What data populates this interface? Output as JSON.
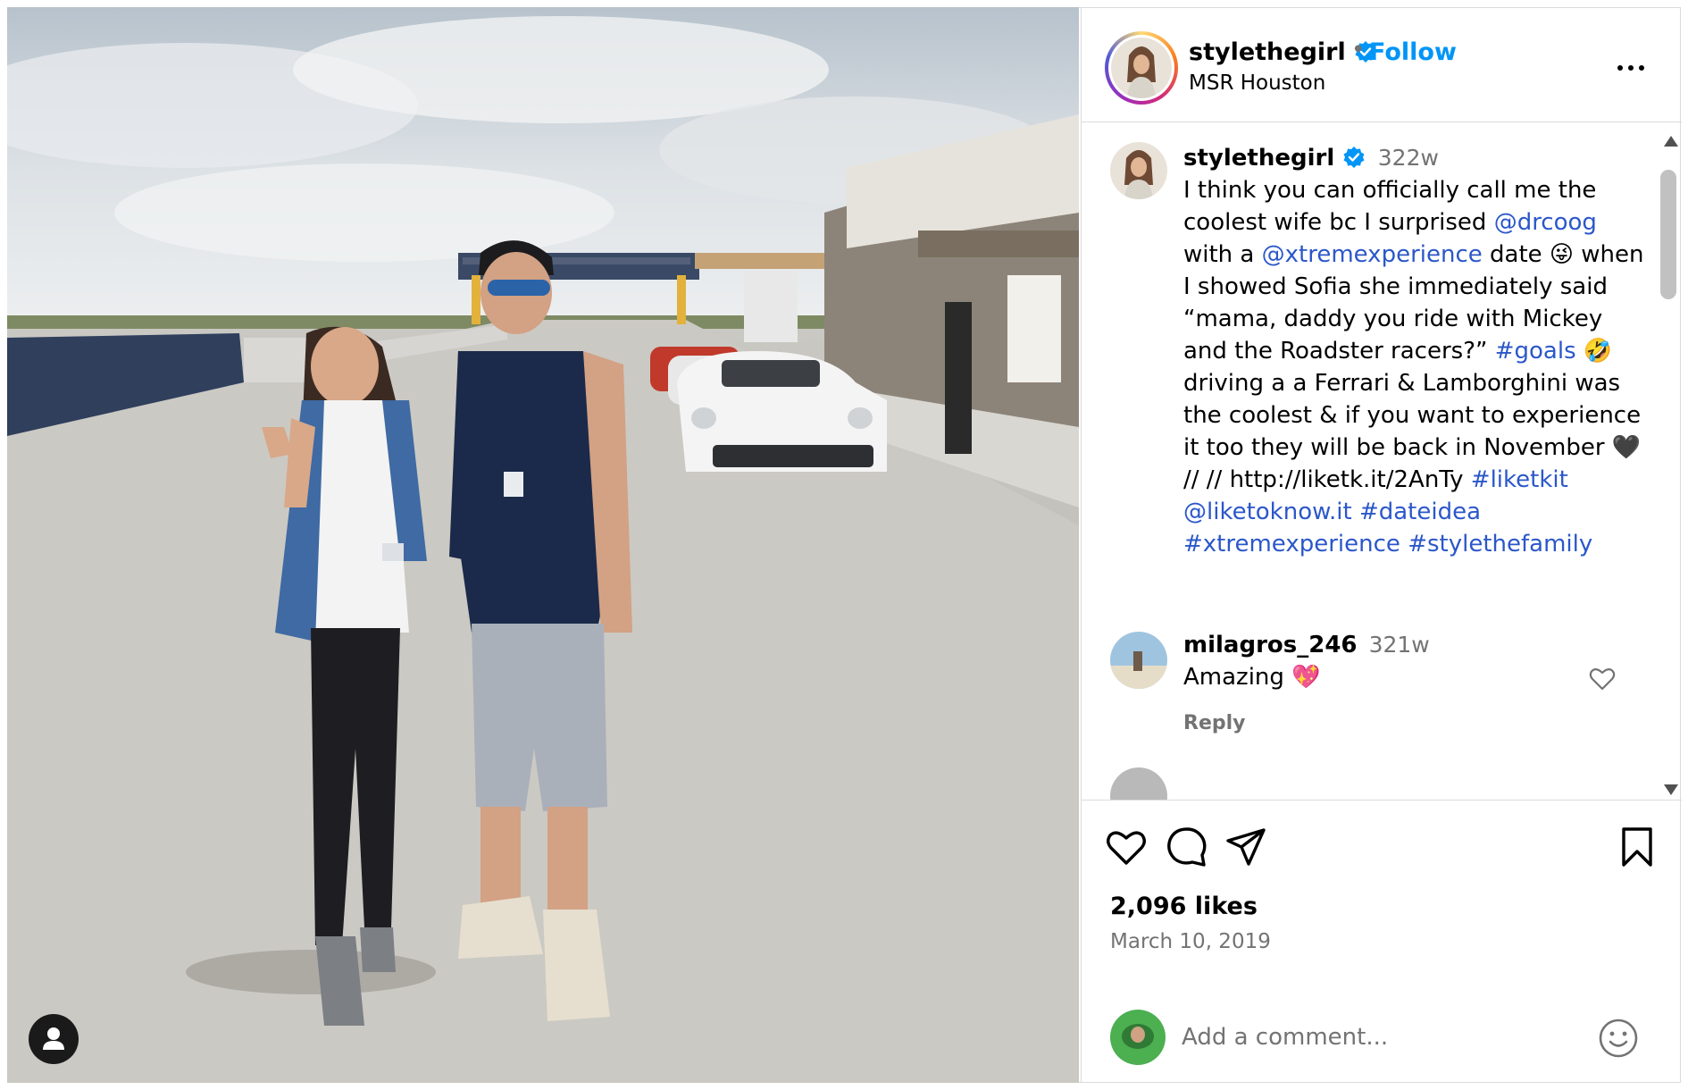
{
  "post": {
    "username": "stylethegirl",
    "follow_label": "Follow",
    "separator": "•",
    "location": "MSR Houston"
  },
  "caption": {
    "username": "stylethegirl",
    "time": "322w",
    "segments": [
      {
        "text": "I think you can officially call me the coolest wife bc I surprised ",
        "type": "text"
      },
      {
        "text": "@drcoog",
        "type": "link"
      },
      {
        "text": " with a ",
        "type": "text"
      },
      {
        "text": "@xtremexperience",
        "type": "link"
      },
      {
        "text": " date 😜 when I showed Sofia she immediately said “mama, daddy you ride with Mickey and the Roadster racers?” ",
        "type": "text"
      },
      {
        "text": "#goals",
        "type": "link"
      },
      {
        "text": " 🤣 driving a a Ferrari & Lamborghini was the coolest & if you want to experience it too they will be back in November 🖤 // // http://liketk.it/2AnTy ",
        "type": "text"
      },
      {
        "text": "#liketkit",
        "type": "link"
      },
      {
        "text": " ",
        "type": "text"
      },
      {
        "text": "@liketoknow.it",
        "type": "link"
      },
      {
        "text": " ",
        "type": "text"
      },
      {
        "text": "#dateidea",
        "type": "link"
      },
      {
        "text": " ",
        "type": "text"
      },
      {
        "text": "#xtremexperience",
        "type": "link"
      },
      {
        "text": " ",
        "type": "text"
      },
      {
        "text": "#stylethefamily",
        "type": "link"
      }
    ]
  },
  "comment": {
    "username": "milagros_246",
    "time": "321w",
    "text": "Amazing 💖",
    "reply_label": "Reply"
  },
  "stats": {
    "likes": "2,096 likes",
    "date": "March 10, 2019"
  },
  "add_comment": {
    "placeholder": "Add a comment..."
  },
  "colors": {
    "link": "#2b57c9",
    "follow": "#0095f6",
    "verified": "#0095f6",
    "muted": "#737373",
    "border": "#dbdbdb"
  },
  "icons": [
    "verified-badge-icon",
    "more-options-icon",
    "heart-icon",
    "comment-icon",
    "share-icon",
    "bookmark-icon",
    "emoji-icon",
    "user-tag-icon",
    "scroll-up-icon",
    "scroll-down-icon"
  ]
}
